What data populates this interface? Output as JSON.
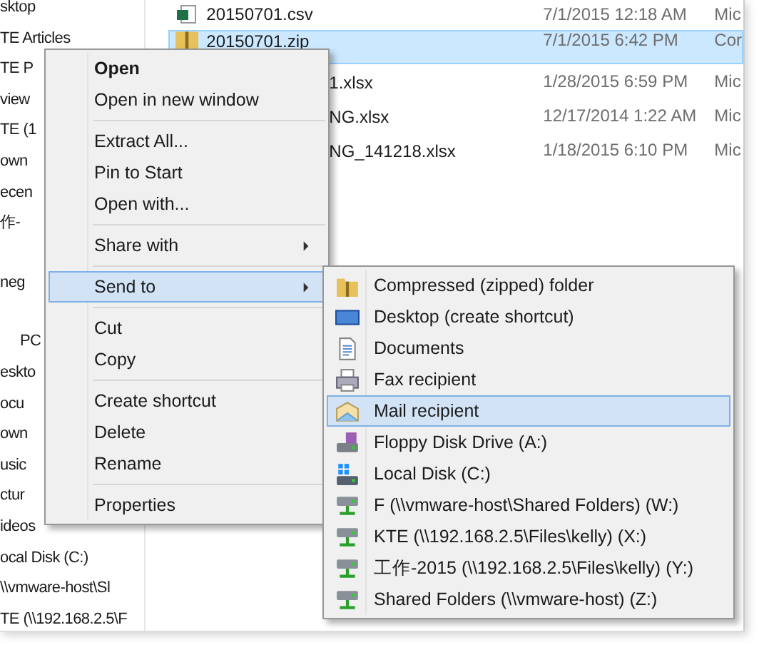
{
  "nav_pane": {
    "groups": [
      {
        "items": [
          "sktop",
          "TE Articles",
          "TE P",
          "view",
          "TE (1",
          "own",
          "ecen",
          "作-"
        ]
      },
      {
        "items": [
          "neg"
        ]
      },
      {
        "items": [
          "PC",
          "eskto",
          "ocu",
          "own",
          "usic",
          "ctur",
          "ideos",
          "ocal Disk (C:)",
          "\\\\vmware-host\\Sl",
          "TE (\\\\192.168.2.5\\F"
        ]
      }
    ]
  },
  "file_list": {
    "rows": [
      {
        "name": "20150701.csv",
        "modified": "7/1/2015 12:18 AM",
        "type": "Mic",
        "selected": false
      },
      {
        "name": "20150701.zip",
        "modified": "7/1/2015 6:42 PM",
        "type": "Cor",
        "selected": true
      },
      {
        "name": "1.xlsx",
        "modified": "1/28/2015 6:59 PM",
        "type": "Mic",
        "selected": false
      },
      {
        "name": "NG.xlsx",
        "modified": "12/17/2014 1:22 AM",
        "type": "Mic",
        "selected": false
      },
      {
        "name": "NG_141218.xlsx",
        "modified": "1/18/2015 6:10 PM",
        "type": "Mic",
        "selected": false
      }
    ]
  },
  "context_menu": {
    "items": [
      {
        "kind": "item",
        "label": "Open",
        "default": true,
        "submenu": false,
        "selected": false
      },
      {
        "kind": "item",
        "label": "Open in new window",
        "default": false,
        "submenu": false,
        "selected": false
      },
      {
        "kind": "separator"
      },
      {
        "kind": "item",
        "label": "Extract All...",
        "default": false,
        "submenu": false,
        "selected": false
      },
      {
        "kind": "item",
        "label": "Pin to Start",
        "default": false,
        "submenu": false,
        "selected": false
      },
      {
        "kind": "item",
        "label": "Open with...",
        "default": false,
        "submenu": false,
        "selected": false
      },
      {
        "kind": "separator"
      },
      {
        "kind": "item",
        "label": "Share with",
        "default": false,
        "submenu": true,
        "selected": false
      },
      {
        "kind": "separator"
      },
      {
        "kind": "item",
        "label": "Send to",
        "default": false,
        "submenu": true,
        "selected": true
      },
      {
        "kind": "separator"
      },
      {
        "kind": "item",
        "label": "Cut",
        "default": false,
        "submenu": false,
        "selected": false
      },
      {
        "kind": "item",
        "label": "Copy",
        "default": false,
        "submenu": false,
        "selected": false
      },
      {
        "kind": "separator"
      },
      {
        "kind": "item",
        "label": "Create shortcut",
        "default": false,
        "submenu": false,
        "selected": false
      },
      {
        "kind": "item",
        "label": "Delete",
        "default": false,
        "submenu": false,
        "selected": false
      },
      {
        "kind": "item",
        "label": "Rename",
        "default": false,
        "submenu": false,
        "selected": false
      },
      {
        "kind": "separator"
      },
      {
        "kind": "item",
        "label": "Properties",
        "default": false,
        "submenu": false,
        "selected": false
      }
    ]
  },
  "send_to_menu": {
    "items": [
      {
        "kind": "zip",
        "label": "Compressed (zipped) folder",
        "selected": false
      },
      {
        "kind": "desktop",
        "label": "Desktop (create shortcut)",
        "selected": false
      },
      {
        "kind": "document",
        "label": "Documents",
        "selected": false
      },
      {
        "kind": "fax",
        "label": "Fax recipient",
        "selected": false
      },
      {
        "kind": "mail",
        "label": "Mail recipient",
        "selected": true
      },
      {
        "kind": "floppy",
        "label": "Floppy Disk Drive (A:)",
        "selected": false
      },
      {
        "kind": "local-disk",
        "label": "Local Disk (C:)",
        "selected": false
      },
      {
        "kind": "network",
        "label": "F (\\\\vmware-host\\Shared Folders) (W:)",
        "selected": false
      },
      {
        "kind": "network",
        "label": "KTE (\\\\192.168.2.5\\Files\\kelly) (X:)",
        "selected": false
      },
      {
        "kind": "network",
        "label": "工作-2015 (\\\\192.168.2.5\\Files\\kelly) (Y:)",
        "selected": false
      },
      {
        "kind": "network",
        "label": "Shared Folders (\\\\vmware-host) (Z:)",
        "selected": false
      }
    ]
  }
}
